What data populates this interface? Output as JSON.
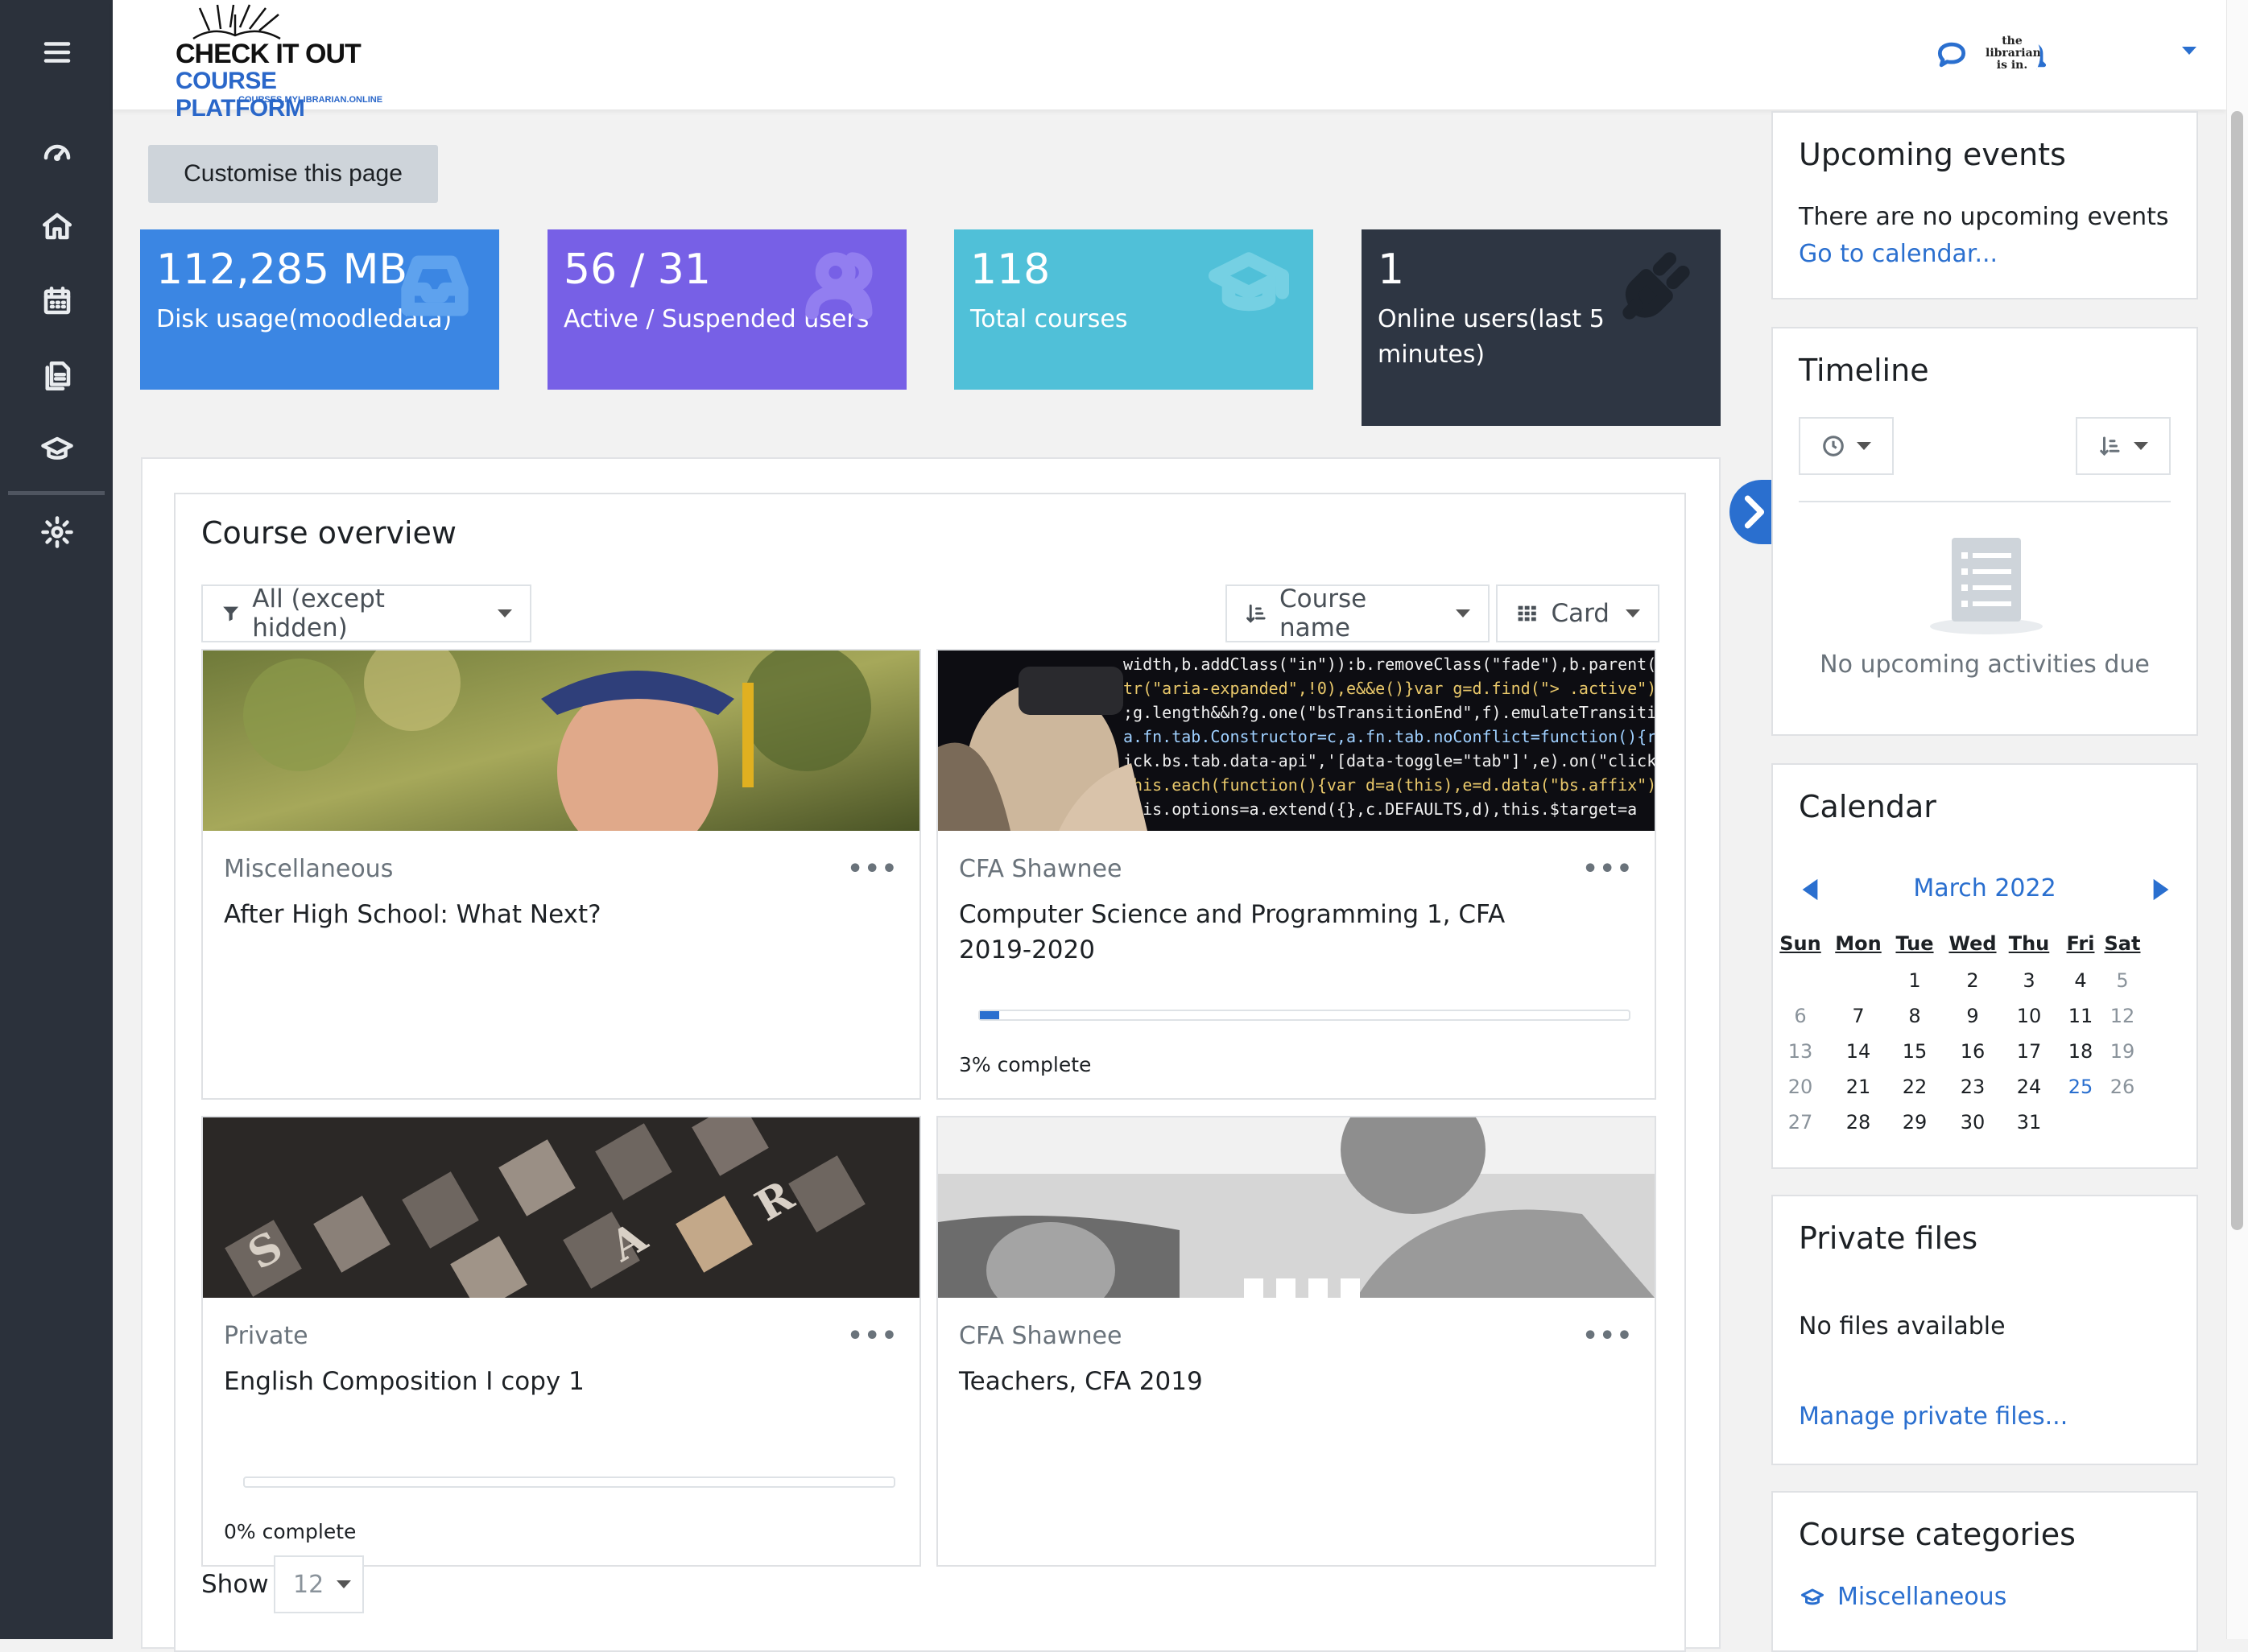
{
  "logo": {
    "line1": "CHECK IT OUT",
    "line2": "COURSE PLATFORM",
    "url": "COURSES.MYLIBRARIAN.ONLINE"
  },
  "user": {
    "avatar_text": "the librarian is in."
  },
  "main": {
    "customise_label": "Customise this page",
    "stats": [
      {
        "value": "112,285 MB",
        "label": "Disk usage(moodledata)",
        "color": "#3b86e3",
        "icon": "inbox-icon"
      },
      {
        "value": "56 / 31",
        "label": "Active / Suspended users",
        "color": "#7760e6",
        "icon": "users-icon"
      },
      {
        "value": "118",
        "label": "Total courses",
        "color": "#50c0d8",
        "icon": "graduation-cap-icon"
      },
      {
        "value": "1",
        "label": "Online users(last 5 minutes)",
        "color": "#2e3643",
        "icon": "plug-icon"
      }
    ]
  },
  "overview": {
    "title": "Course overview",
    "filter_label": "All (except hidden)",
    "sort_label": "Course name",
    "view_label": "Card",
    "show_label": "Show",
    "per_page": "12",
    "courses": [
      {
        "category": "Miscellaneous",
        "title": "After High School: What Next?",
        "progress": null
      },
      {
        "category": "CFA Shawnee",
        "title": "Computer Science and Programming 1, CFA 2019-2020",
        "progress": 3,
        "progress_text": "3% complete"
      },
      {
        "category": "Private",
        "title": "English Composition I copy 1",
        "progress": 0,
        "progress_text": "0% complete"
      },
      {
        "category": "CFA Shawnee",
        "title": "Teachers, CFA 2019",
        "progress": null
      }
    ]
  },
  "upcoming": {
    "title": "Upcoming events",
    "empty": "There are no upcoming events",
    "link": "Go to calendar..."
  },
  "timeline": {
    "title": "Timeline",
    "empty": "No upcoming activities due"
  },
  "calendar": {
    "title": "Calendar",
    "month": "March 2022",
    "days": [
      "Sun",
      "Mon",
      "Tue",
      "Wed",
      "Thu",
      "Fri",
      "Sat"
    ],
    "weeks": [
      [
        "",
        "",
        "1",
        "2",
        "3",
        "4",
        "5"
      ],
      [
        "6",
        "7",
        "8",
        "9",
        "10",
        "11",
        "12"
      ],
      [
        "13",
        "14",
        "15",
        "16",
        "17",
        "18",
        "19"
      ],
      [
        "20",
        "21",
        "22",
        "23",
        "24",
        "25",
        "26"
      ],
      [
        "27",
        "28",
        "29",
        "30",
        "31",
        "",
        ""
      ]
    ],
    "today": "25"
  },
  "private_files": {
    "title": "Private files",
    "empty": "No files available",
    "link": "Manage private files..."
  },
  "categories": {
    "title": "Course categories",
    "items": [
      "Miscellaneous"
    ]
  },
  "colors": {
    "accent": "#2a6fcf",
    "rail": "#2b313b"
  }
}
